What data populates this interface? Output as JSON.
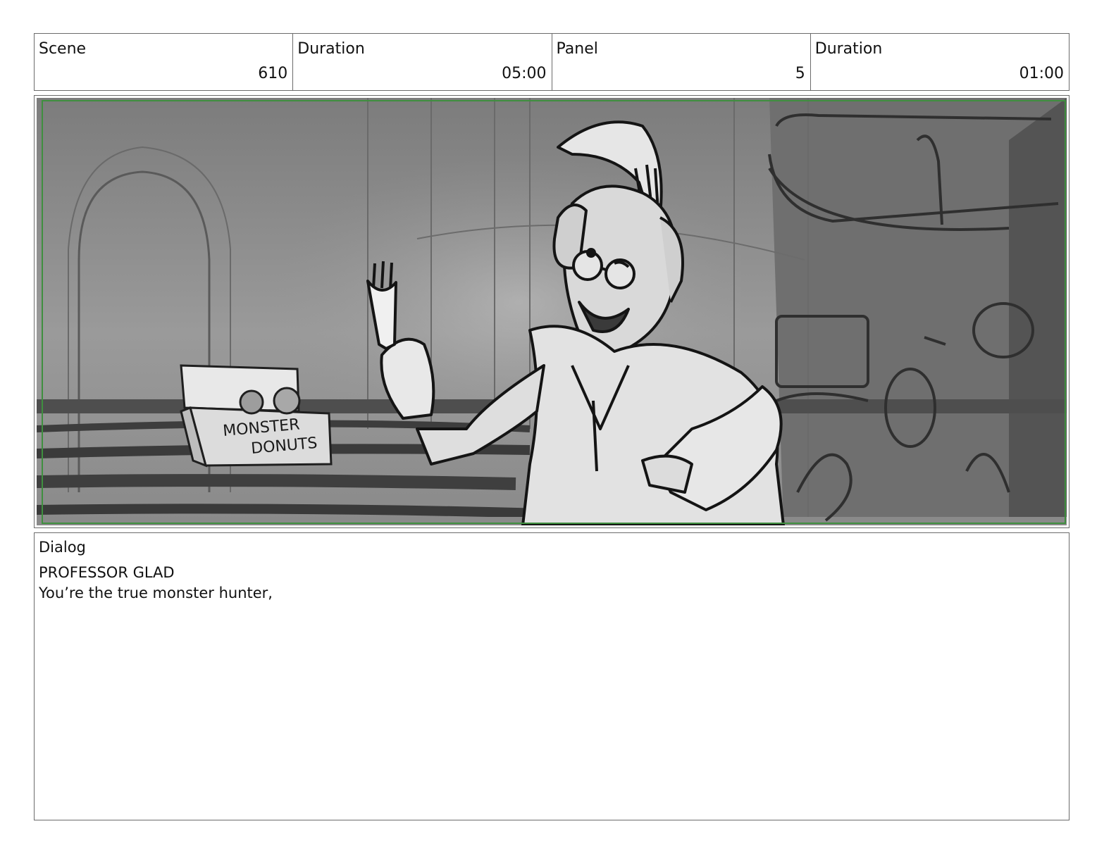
{
  "header": {
    "scene_label": "Scene",
    "scene_value": "610",
    "scene_duration_label": "Duration",
    "scene_duration_value": "05:00",
    "panel_label": "Panel",
    "panel_value": "5",
    "panel_duration_label": "Duration",
    "panel_duration_value": "01:00"
  },
  "artwork": {
    "box_lettering": [
      "MONSTER",
      "DONUTS"
    ]
  },
  "dialog": {
    "label": "Dialog",
    "speaker": "PROFESSOR GLAD",
    "line": "You’re the true monster hunter,"
  }
}
